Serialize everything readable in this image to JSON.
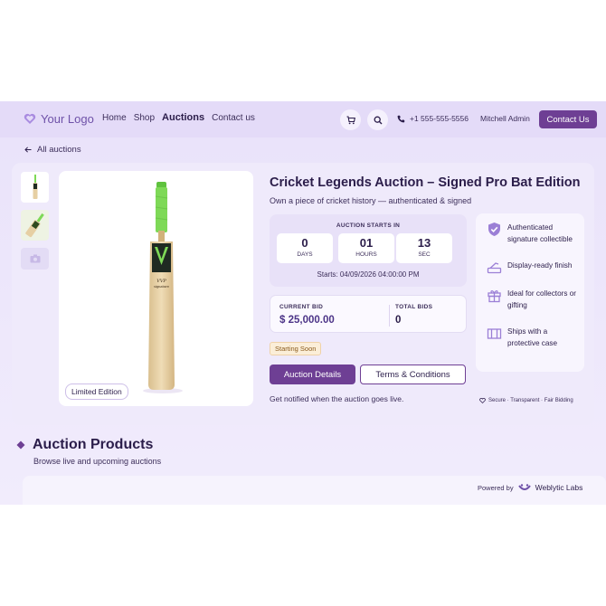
{
  "header": {
    "logo_text": "Your Logo",
    "nav": [
      "Home",
      "Shop",
      "Auctions",
      "Contact us"
    ],
    "active_nav": "Auctions",
    "phone": "+1 555-555-5556",
    "user": "Mitchell Admin",
    "contact_button": "Contact Us"
  },
  "breadcrumb": {
    "back_label": "All auctions"
  },
  "product": {
    "title": "Cricket Legends Auction – Signed Pro Bat Edition",
    "subtitle": "Own a piece of cricket history — authenticated & signed",
    "image_badge": "Limited Edition"
  },
  "countdown": {
    "label": "AUCTION STARTS IN",
    "units": [
      {
        "value": "0",
        "unit": "DAYS"
      },
      {
        "value": "01",
        "unit": "HOURS"
      },
      {
        "value": "13",
        "unit": "SEC"
      }
    ],
    "starts_text": "Starts: 04/09/2026 04:00:00 PM"
  },
  "bid": {
    "current_label": "CURRENT BID",
    "current_value": "$ 25,000.00",
    "total_label": "TOTAL BIDS",
    "total_value": "0"
  },
  "status_badge": "Starting Soon",
  "buttons": {
    "details": "Auction Details",
    "terms": "Terms & Conditions"
  },
  "notify_text": "Get notified when the auction goes live.",
  "features": [
    {
      "icon": "shield-check-icon",
      "text": "Authenticated signature collectible"
    },
    {
      "icon": "display-stand-icon",
      "text": "Display-ready finish"
    },
    {
      "icon": "gift-icon",
      "text": "Ideal for collectors or gifting"
    },
    {
      "icon": "box-icon",
      "text": "Ships with a protective case"
    }
  ],
  "secure_text": "Secure · Transparent · Fair Bidding",
  "products_section": {
    "title": "Auction Products",
    "subtitle": "Browse live and upcoming auctions"
  },
  "powered": {
    "label": "Powered by",
    "brand": "Weblytic Labs"
  },
  "colors": {
    "primary": "#6e3f94",
    "accent": "#9b7fd6",
    "bat_grip": "#7ed957"
  }
}
